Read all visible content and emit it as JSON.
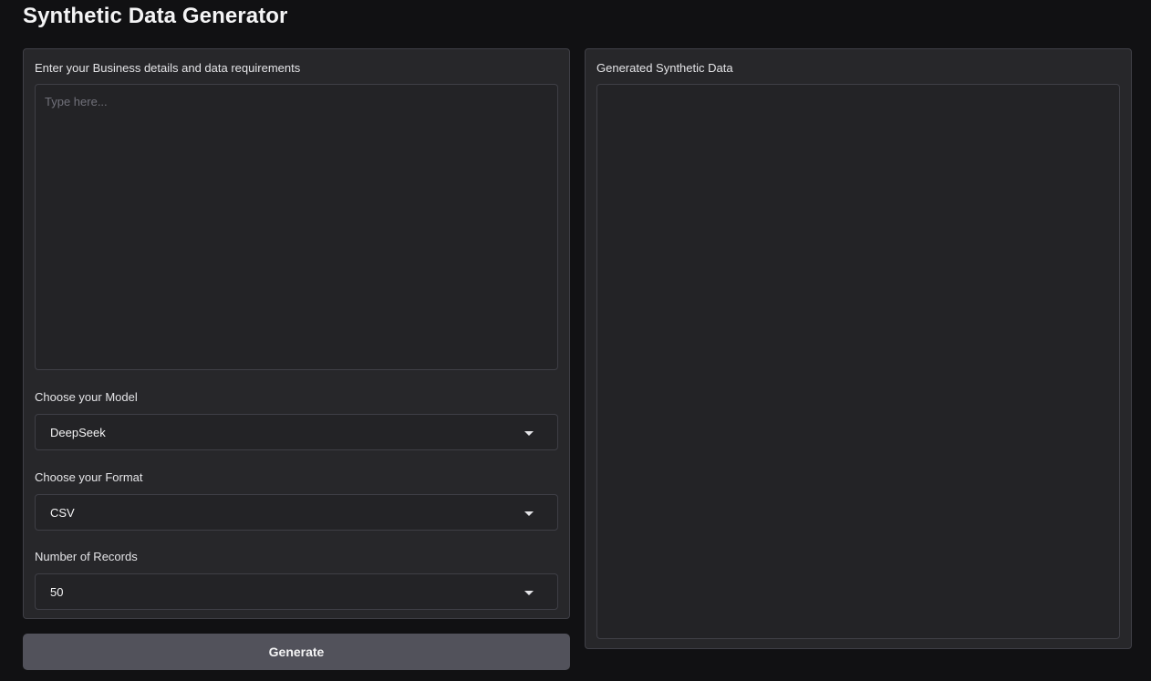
{
  "app": {
    "title": "Synthetic Data Generator"
  },
  "input_panel": {
    "business_label": "Enter your Business details and data requirements",
    "business_placeholder": "Type here...",
    "business_value": "",
    "model_label": "Choose your Model",
    "model_value": "DeepSeek",
    "format_label": "Choose your Format",
    "format_value": "CSV",
    "records_label": "Number of Records",
    "records_value": "50"
  },
  "output_panel": {
    "label": "Generated Synthetic Data",
    "value": ""
  },
  "actions": {
    "generate_label": "Generate"
  },
  "colors": {
    "background": "#111113",
    "panel": "#27272a",
    "field": "#232326",
    "border": "#3f3f46",
    "button": "#52525b"
  }
}
